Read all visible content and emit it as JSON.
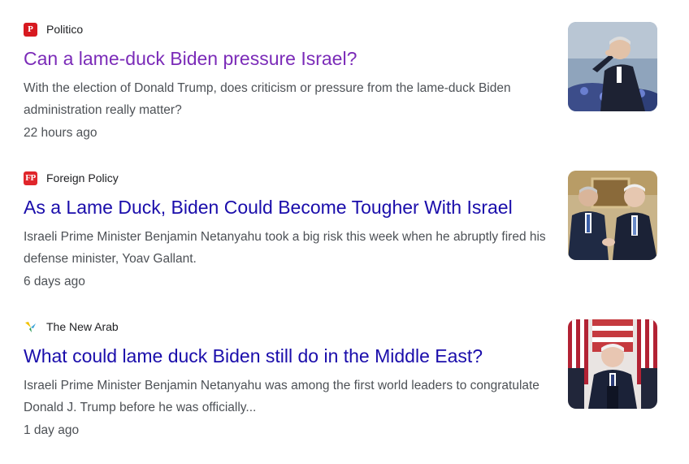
{
  "results": [
    {
      "source": "Politico",
      "logo_text": "P",
      "title": "Can a lame-duck Biden pressure Israel?",
      "snippet": "With the election of Donald Trump, does criticism or pressure from the lame-duck Biden administration really matter?",
      "time": "22 hours ago",
      "visited": true,
      "thumbnail_icon": "saluting-man-photo"
    },
    {
      "source": "Foreign Policy",
      "logo_text": "FP",
      "title": "As a Lame Duck, Biden Could Become Tougher With Israel",
      "snippet": "Israeli Prime Minister Benjamin Netanyahu took a big risk this week when he abruptly fired his defense minister, Yoav Gallant.",
      "time": "6 days ago",
      "visited": false,
      "thumbnail_icon": "two-leaders-photo"
    },
    {
      "source": "The New Arab",
      "logo_text": "",
      "title": "What could lame duck Biden still do in the Middle East?",
      "snippet": "Israeli Prime Minister Benjamin Netanyahu was among the first world leaders to congratulate Donald J. Trump before he was officially...",
      "time": "1 day ago",
      "visited": false,
      "thumbnail_icon": "podium-speech-photo"
    }
  ],
  "colors": {
    "visited_link": "#7b2bb8",
    "link": "#1a0dab",
    "snippet": "#4d5156",
    "source": "#202124"
  }
}
